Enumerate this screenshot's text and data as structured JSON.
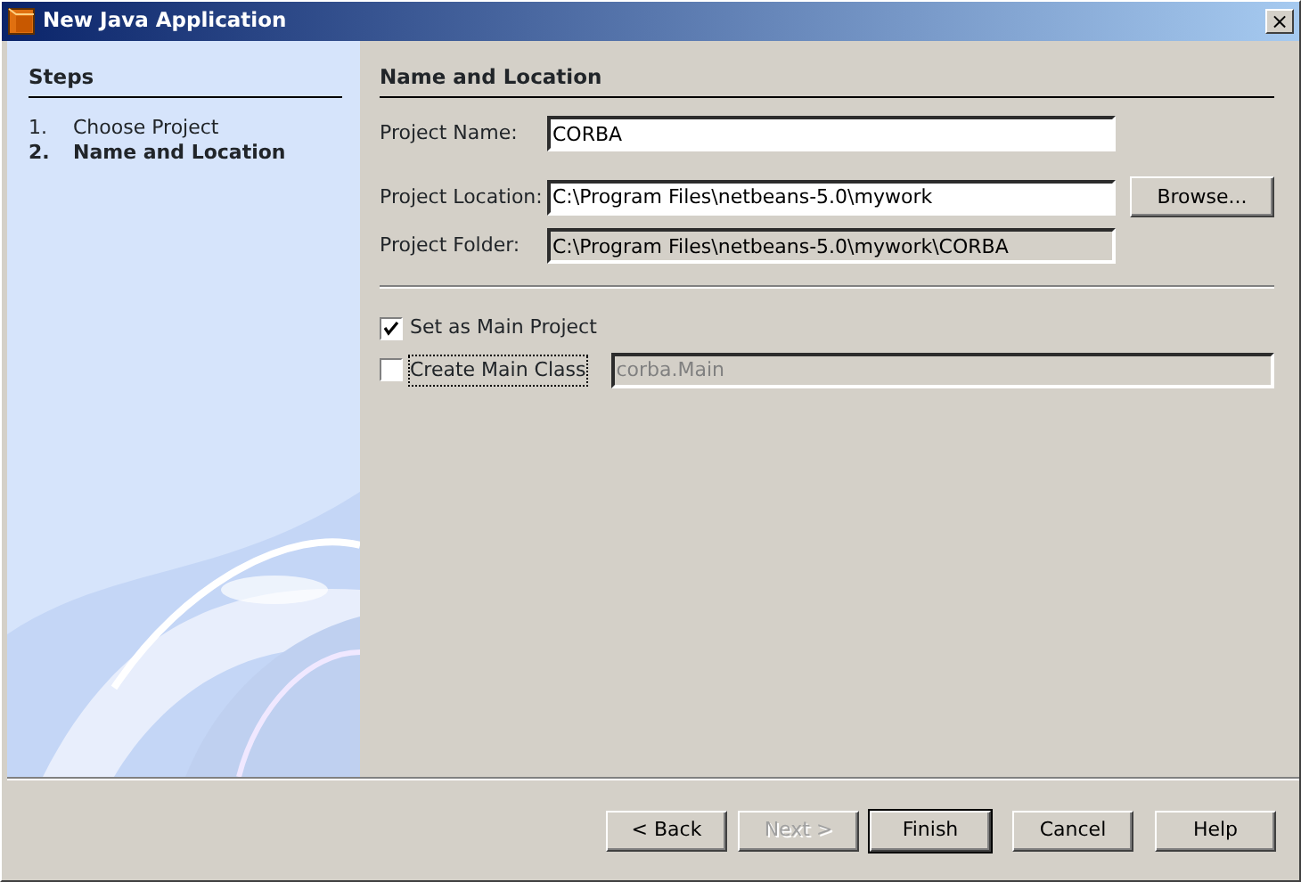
{
  "window": {
    "title": "New Java Application",
    "close": "×"
  },
  "steps": {
    "title": "Steps",
    "items": [
      {
        "number": "1.",
        "label": "Choose Project",
        "selected": false
      },
      {
        "number": "2.",
        "label": "Name and Location",
        "selected": true
      }
    ]
  },
  "panel": {
    "title": "Name and Location",
    "fields": [
      {
        "label": "Project Name:",
        "value": "CORBA",
        "disabled": false
      },
      {
        "label": "Project Location:",
        "value": "C:\\Program Files\\netbeans-5.0\\mywork",
        "disabled": false,
        "button": "Browse..."
      },
      {
        "label": "Project Folder:",
        "value": "C:\\Program Files\\netbeans-5.0\\mywork\\CORBA",
        "disabled": true
      }
    ],
    "options": [
      {
        "label": "Set as Main Project",
        "checked": true
      },
      {
        "label": "Create Main Class",
        "checked": false,
        "focused": true,
        "field": {
          "value": "corba.Main",
          "disabled": true
        }
      }
    ]
  },
  "buttons": [
    {
      "label": "< Back",
      "disabled": false,
      "default": false
    },
    {
      "label": "Next >",
      "disabled": true,
      "default": false
    },
    {
      "label": "Finish",
      "disabled": false,
      "default": true
    },
    {
      "label": "Cancel",
      "disabled": false,
      "default": false
    },
    {
      "label": "Help",
      "disabled": false,
      "default": false
    }
  ]
}
